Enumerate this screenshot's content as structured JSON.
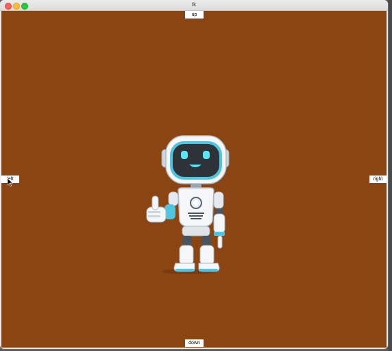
{
  "window": {
    "title": "tk"
  },
  "canvas": {
    "background": "#8b4513"
  },
  "controls": {
    "up_label": "up",
    "down_label": "down",
    "left_label": "left",
    "right_label": "right"
  },
  "sprite": {
    "icon": "robot-thumbs-up",
    "accent": "#4fd6e8"
  }
}
